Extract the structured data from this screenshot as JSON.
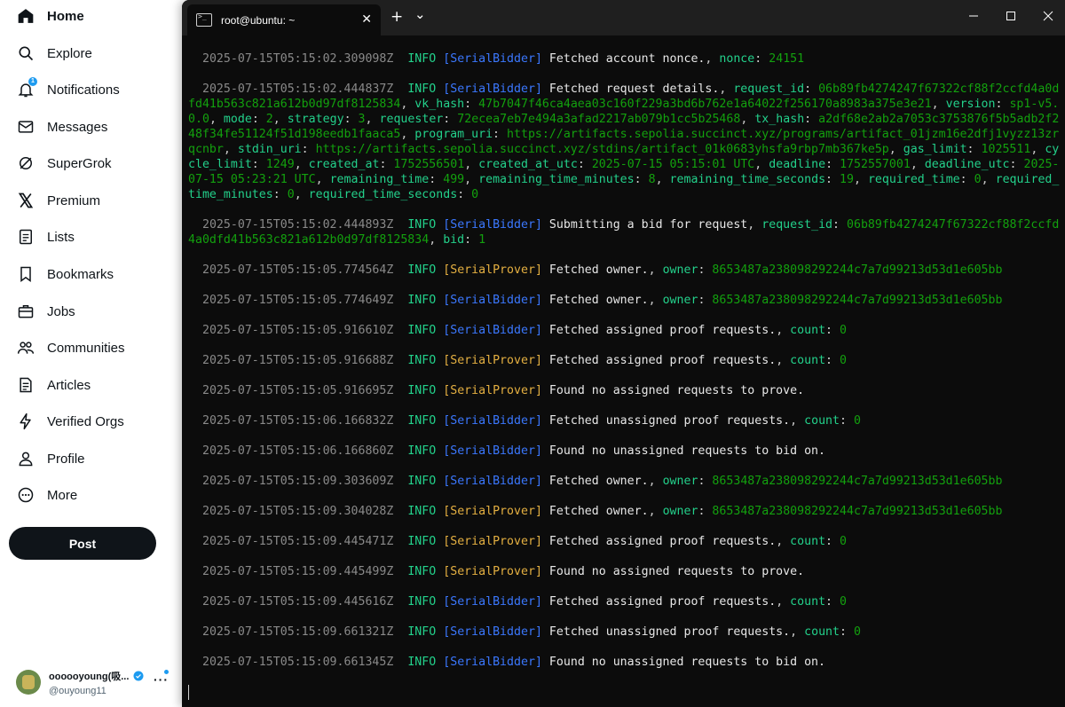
{
  "sidebar": {
    "items": [
      {
        "label": "Home",
        "icon": "home-icon"
      },
      {
        "label": "Explore",
        "icon": "search-icon"
      },
      {
        "label": "Notifications",
        "icon": "bell-icon",
        "badge": "1"
      },
      {
        "label": "Messages",
        "icon": "mail-icon"
      },
      {
        "label": "SuperGrok",
        "icon": "grok-icon"
      },
      {
        "label": "Premium",
        "icon": "x-logo-icon"
      },
      {
        "label": "Lists",
        "icon": "list-icon"
      },
      {
        "label": "Bookmarks",
        "icon": "bookmark-icon"
      },
      {
        "label": "Jobs",
        "icon": "briefcase-icon"
      },
      {
        "label": "Communities",
        "icon": "people-icon"
      },
      {
        "label": "Articles",
        "icon": "article-icon"
      },
      {
        "label": "Verified Orgs",
        "icon": "lightning-icon"
      },
      {
        "label": "Profile",
        "icon": "person-icon"
      },
      {
        "label": "More",
        "icon": "more-circle-icon"
      }
    ],
    "post_label": "Post",
    "account": {
      "name": "oooooyoung(吸...",
      "handle": "@ouyoung11"
    }
  },
  "terminal": {
    "tab_title": "root@ubuntu: ~",
    "new_tab": "+",
    "dropdown": "⌄",
    "logs": [
      {
        "ts": "2025-07-15T05:15:02.309098Z",
        "level": "INFO",
        "target": "[SerialBidder]",
        "kind": "bidder",
        "msg": "Fetched account nonce.",
        "fields": [
          [
            "nonce",
            "24151"
          ]
        ]
      },
      {
        "ts": "2025-07-15T05:15:02.444837Z",
        "level": "INFO",
        "target": "[SerialBidder]",
        "kind": "bidder",
        "msg": "Fetched request details.",
        "fields": [
          [
            "request_id",
            "06b89fb4274247f67322cf88f2ccfd4a0dfd41b563c821a612b0d97df8125834"
          ],
          [
            "vk_hash",
            "47b7047f46ca4aea03c160f229a3bd6b762e1a64022f256170a8983a375e3e21"
          ],
          [
            "version",
            "sp1-v5.0.0"
          ],
          [
            "mode",
            "2"
          ],
          [
            "strategy",
            "3"
          ],
          [
            "requester",
            "72ecea7eb7e494a3afad2217ab079b1cc5b25468"
          ],
          [
            "tx_hash",
            "a2df68e2ab2a7053c3753876f5b5adb2f248f34fe51124f51d198eedb1faaca5"
          ],
          [
            "program_uri",
            "https://artifacts.sepolia.succinct.xyz/programs/artifact_01jzm16e2dfj1vyzz13zrqcnbr"
          ],
          [
            "stdin_uri",
            "https://artifacts.sepolia.succinct.xyz/stdins/artifact_01k0683yhsfa9rbp7mb367ke5p"
          ],
          [
            "gas_limit",
            "1025511"
          ],
          [
            "cycle_limit",
            "1249"
          ],
          [
            "created_at",
            "1752556501"
          ],
          [
            "created_at_utc",
            "2025-07-15 05:15:01 UTC"
          ],
          [
            "deadline",
            "1752557001"
          ],
          [
            "deadline_utc",
            "2025-07-15 05:23:21 UTC"
          ],
          [
            "remaining_time",
            "499"
          ],
          [
            "remaining_time_minutes",
            "8"
          ],
          [
            "remaining_time_seconds",
            "19"
          ],
          [
            "required_time",
            "0"
          ],
          [
            "required_time_minutes",
            "0"
          ],
          [
            "required_time_seconds",
            "0"
          ]
        ]
      },
      {
        "ts": "2025-07-15T05:15:02.444893Z",
        "level": "INFO",
        "target": "[SerialBidder]",
        "kind": "bidder",
        "msg": "Submitting a bid for request",
        "fields": [
          [
            "request_id",
            "06b89fb4274247f67322cf88f2ccfd4a0dfd41b563c821a612b0d97df8125834"
          ],
          [
            "bid",
            "1"
          ]
        ]
      },
      {
        "ts": "2025-07-15T05:15:05.774564Z",
        "level": "INFO",
        "target": "[SerialProver]",
        "kind": "prover",
        "msg": "Fetched owner.",
        "fields": [
          [
            "owner",
            "8653487a238098292244c7a7d99213d53d1e605bb"
          ]
        ]
      },
      {
        "ts": "2025-07-15T05:15:05.774649Z",
        "level": "INFO",
        "target": "[SerialBidder]",
        "kind": "bidder",
        "msg": "Fetched owner.",
        "fields": [
          [
            "owner",
            "8653487a238098292244c7a7d99213d53d1e605bb"
          ]
        ]
      },
      {
        "ts": "2025-07-15T05:15:05.916610Z",
        "level": "INFO",
        "target": "[SerialBidder]",
        "kind": "bidder",
        "msg": "Fetched assigned proof requests.",
        "fields": [
          [
            "count",
            "0"
          ]
        ]
      },
      {
        "ts": "2025-07-15T05:15:05.916688Z",
        "level": "INFO",
        "target": "[SerialProver]",
        "kind": "prover",
        "msg": "Fetched assigned proof requests.",
        "fields": [
          [
            "count",
            "0"
          ]
        ]
      },
      {
        "ts": "2025-07-15T05:15:05.916695Z",
        "level": "INFO",
        "target": "[SerialProver]",
        "kind": "prover",
        "msg": "Found no assigned requests to prove.",
        "fields": []
      },
      {
        "ts": "2025-07-15T05:15:06.166832Z",
        "level": "INFO",
        "target": "[SerialBidder]",
        "kind": "bidder",
        "msg": "Fetched unassigned proof requests.",
        "fields": [
          [
            "count",
            "0"
          ]
        ]
      },
      {
        "ts": "2025-07-15T05:15:06.166860Z",
        "level": "INFO",
        "target": "[SerialBidder]",
        "kind": "bidder",
        "msg": "Found no unassigned requests to bid on.",
        "fields": []
      },
      {
        "ts": "2025-07-15T05:15:09.303609Z",
        "level": "INFO",
        "target": "[SerialBidder]",
        "kind": "bidder",
        "msg": "Fetched owner.",
        "fields": [
          [
            "owner",
            "8653487a238098292244c7a7d99213d53d1e605bb"
          ]
        ]
      },
      {
        "ts": "2025-07-15T05:15:09.304028Z",
        "level": "INFO",
        "target": "[SerialProver]",
        "kind": "prover",
        "msg": "Fetched owner.",
        "fields": [
          [
            "owner",
            "8653487a238098292244c7a7d99213d53d1e605bb"
          ]
        ]
      },
      {
        "ts": "2025-07-15T05:15:09.445471Z",
        "level": "INFO",
        "target": "[SerialProver]",
        "kind": "prover",
        "msg": "Fetched assigned proof requests.",
        "fields": [
          [
            "count",
            "0"
          ]
        ]
      },
      {
        "ts": "2025-07-15T05:15:09.445499Z",
        "level": "INFO",
        "target": "[SerialProver]",
        "kind": "prover",
        "msg": "Found no assigned requests to prove.",
        "fields": []
      },
      {
        "ts": "2025-07-15T05:15:09.445616Z",
        "level": "INFO",
        "target": "[SerialBidder]",
        "kind": "bidder",
        "msg": "Fetched assigned proof requests.",
        "fields": [
          [
            "count",
            "0"
          ]
        ]
      },
      {
        "ts": "2025-07-15T05:15:09.661321Z",
        "level": "INFO",
        "target": "[SerialBidder]",
        "kind": "bidder",
        "msg": "Fetched unassigned proof requests.",
        "fields": [
          [
            "count",
            "0"
          ]
        ]
      },
      {
        "ts": "2025-07-15T05:15:09.661345Z",
        "level": "INFO",
        "target": "[SerialBidder]",
        "kind": "bidder",
        "msg": "Found no unassigned requests to bid on.",
        "fields": []
      }
    ]
  },
  "colors": {
    "terminal_bg": "#0c0c0c",
    "bidder_tag": "#3b78ff",
    "prover_tag": "#e5b041",
    "info_level": "#23d18b",
    "timestamp": "#8a8a8a",
    "post_button": "#0f1419",
    "accent": "#1d9bf0"
  }
}
